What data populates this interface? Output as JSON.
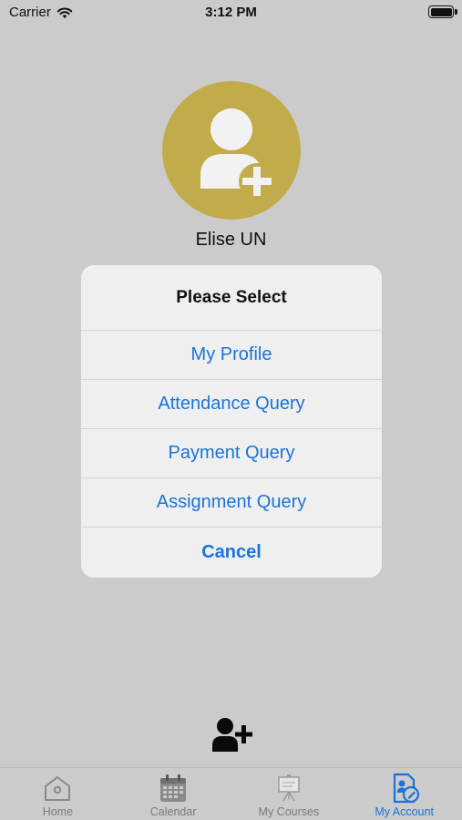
{
  "status_bar": {
    "carrier": "Carrier",
    "time": "3:12 PM"
  },
  "profile": {
    "name": "Elise UN",
    "avatar_icon": "add-user-icon",
    "avatar_color": "#c2ab4a"
  },
  "action_sheet": {
    "title": "Please Select",
    "items": [
      {
        "label": "My Profile"
      },
      {
        "label": "Attendance Query"
      },
      {
        "label": "Payment Query"
      },
      {
        "label": "Assignment Query"
      }
    ],
    "cancel_label": "Cancel",
    "accent_color": "#1a73d9"
  },
  "tab_bar": {
    "tabs": [
      {
        "label": "Home",
        "icon": "home-icon",
        "active": false
      },
      {
        "label": "Calendar",
        "icon": "calendar-icon",
        "active": false
      },
      {
        "label": "My Courses",
        "icon": "courses-board-icon",
        "active": false
      },
      {
        "label": "My Account",
        "icon": "account-document-icon",
        "active": true
      }
    ]
  }
}
